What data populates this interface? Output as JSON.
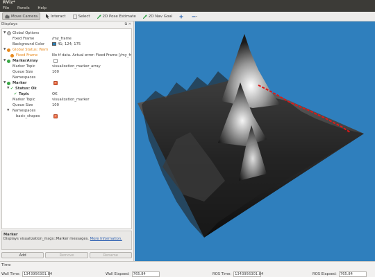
{
  "window": {
    "title": "RViz*"
  },
  "menu": [
    "File",
    "Panels",
    "Help"
  ],
  "toolbar": {
    "move_camera": "Move Camera",
    "interact": "Interact",
    "select": "Select",
    "pose_estimate": "2D Pose Estimate",
    "nav_goal": "2D Nav Goal"
  },
  "displays": {
    "header": "Displays",
    "global_options": "Global Options",
    "fixed_frame_label": "Fixed Frame",
    "fixed_frame_value": "/my_frame",
    "background_color_label": "Background Color",
    "background_color_value": "41; 124; 175",
    "global_status": "Global Status: Warn",
    "fixed_frame_status_label": "Fixed Frame",
    "fixed_frame_status_value": "No tf data.  Actual error: Fixed Frame [/my_frame...",
    "markerarray": "MarkerArray",
    "marker_topic_label": "Marker Topic",
    "markerarray_topic_value": "visualization_marker_array",
    "queue_size_label": "Queue Size",
    "markerarray_queue_value": "100",
    "namespaces_label": "Namespaces",
    "marker": "Marker",
    "status_ok": "Status: Ok",
    "topic_label": "Topic",
    "topic_value": "OK",
    "marker_topic_value": "visualization_marker",
    "marker_queue_value": "100",
    "basic_shapes": "basic_shapes"
  },
  "description": {
    "title": "Marker",
    "text": "Displays visualization_msgs::Marker messages.",
    "link": "More Information."
  },
  "buttons": {
    "add": "Add",
    "remove": "Remove",
    "rename": "Rename"
  },
  "time": {
    "header": "Time",
    "wall_time_label": "Wall Time:",
    "wall_time_value": "1343956301.84",
    "wall_elapsed_label": "Wall Elapsed:",
    "wall_elapsed_value": "765.84",
    "ros_time_label": "ROS Time:",
    "ros_time_value": "1343956301.84",
    "ros_elapsed_label": "ROS Elapsed:",
    "ros_elapsed_value": "765.84"
  },
  "colors": {
    "background": "#2980af",
    "status_warn": "#e8891c",
    "status_ok": "#39a845",
    "marker_path": "#e01818"
  }
}
